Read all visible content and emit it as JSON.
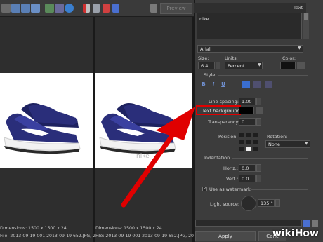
{
  "toolbar": {
    "preview_label": "Preview",
    "icons": [
      "folder-icon",
      "gear-icon",
      "fit-icon",
      "zoom-icon",
      "image-icon",
      "compare-icon",
      "info-icon",
      "layout-split-icon",
      "layout-single-icon",
      "layout-red-icon",
      "layout-blue-icon",
      "color-picker-icon"
    ]
  },
  "left_pane": {
    "dimensions": "Dimensions: 1500 x 1500 x 24",
    "file": "File: 2013-09-19 001 2013-09-19 652.JPG, 20..."
  },
  "right_pane": {
    "dimensions": "Dimensions: 1500 x 1500 x 24",
    "file": "File: 2013-09-19 001 2013-09-19 652.JPG, 2013-09-...",
    "watermark_text": "nike"
  },
  "panel": {
    "title": "Text",
    "text_value": "nike",
    "font": "Arial",
    "size_label": "Size:",
    "size_value": "6.4",
    "units_label": "Units:",
    "units_value": "Percent",
    "color_label": "Color:",
    "style_label": "Style",
    "style_buttons": [
      "B",
      "I",
      "U"
    ],
    "line_spacing_label": "Line spacing:",
    "line_spacing_value": "1.00",
    "text_background_label": "Text background:",
    "transparency_label": "Transparency:",
    "transparency_value": "0",
    "position_label": "Position:",
    "rotation_label": "Rotation:",
    "rotation_value": "None",
    "indentation_label": "Indentation",
    "horiz_label": "Horiz.:",
    "horiz_value": "0.0",
    "vert_label": "Vert.:",
    "vert_value": "0.0",
    "watermark_label": "Use as watermark",
    "light_source_label": "Light source:",
    "light_source_value": "135 °",
    "apply_label": "Apply",
    "cancel_label": "Canc"
  },
  "colors": {
    "highlight": "#e00000",
    "shoe_navy": "#2a2e7a",
    "accent_blue": "#3a6ecf"
  },
  "watermark": {
    "brand_1": "wiki",
    "brand_2": "How"
  }
}
